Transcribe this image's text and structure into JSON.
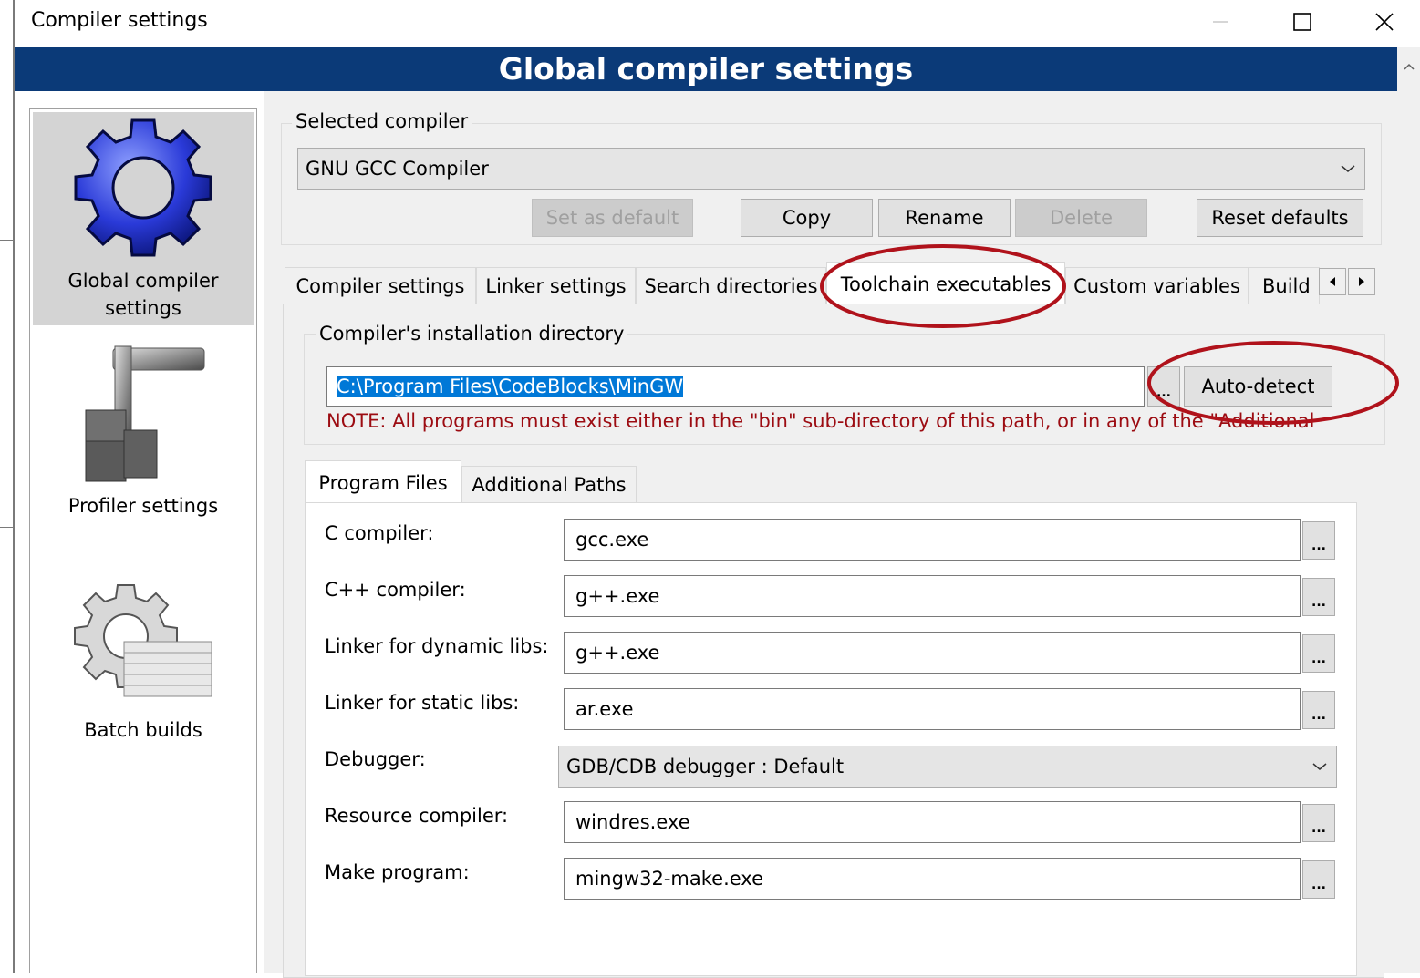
{
  "window": {
    "title": "Compiler settings",
    "minimize_icon": "minimize-icon",
    "maximize_icon": "maximize-icon",
    "close_icon": "close-icon"
  },
  "header": {
    "title": "Global compiler settings"
  },
  "sidebar": {
    "items": [
      {
        "label_line1": "Global compiler",
        "label_line2": "settings",
        "icon": "gear-icon",
        "selected": true
      },
      {
        "label": "Profiler settings",
        "icon": "caliper-icon",
        "selected": false
      },
      {
        "label": "Batch builds",
        "icon": "batch-gear-icon",
        "selected": false
      }
    ]
  },
  "selected_compiler": {
    "group_label": "Selected compiler",
    "value": "GNU GCC Compiler",
    "buttons": {
      "set_default": "Set as default",
      "copy": "Copy",
      "rename": "Rename",
      "delete": "Delete",
      "reset_defaults": "Reset defaults"
    }
  },
  "tabs": [
    {
      "label": "Compiler settings",
      "active": false
    },
    {
      "label": "Linker settings",
      "active": false
    },
    {
      "label": "Search directories",
      "active": false
    },
    {
      "label": "Toolchain executables",
      "active": true
    },
    {
      "label": "Custom variables",
      "active": false
    },
    {
      "label": "Build",
      "active": false
    }
  ],
  "install_dir": {
    "group_label": "Compiler's installation directory",
    "value": "C:\\Program Files\\CodeBlocks\\MinGW",
    "browse_label": "...",
    "autodetect_label": "Auto-detect",
    "note": "NOTE: All programs must exist either in the \"bin\" sub-directory of this path, or in any of the \"Additional"
  },
  "subtabs": [
    {
      "label": "Program Files",
      "active": true
    },
    {
      "label": "Additional Paths",
      "active": false
    }
  ],
  "program_files": [
    {
      "label": "C compiler:",
      "value": "gcc.exe",
      "type": "text"
    },
    {
      "label": "C++ compiler:",
      "value": "g++.exe",
      "type": "text"
    },
    {
      "label": "Linker for dynamic libs:",
      "value": "g++.exe",
      "type": "text"
    },
    {
      "label": "Linker for static libs:",
      "value": "ar.exe",
      "type": "text"
    },
    {
      "label": "Debugger:",
      "value": "GDB/CDB debugger : Default",
      "type": "select"
    },
    {
      "label": "Resource compiler:",
      "value": "windres.exe",
      "type": "text"
    },
    {
      "label": "Make program:",
      "value": "mingw32-make.exe",
      "type": "text"
    }
  ],
  "browse_label": "...",
  "colors": {
    "header_bg": "#0b3a78",
    "annotation": "#b0121b",
    "note_text": "#9c0c12",
    "selection": "#0078d7"
  }
}
